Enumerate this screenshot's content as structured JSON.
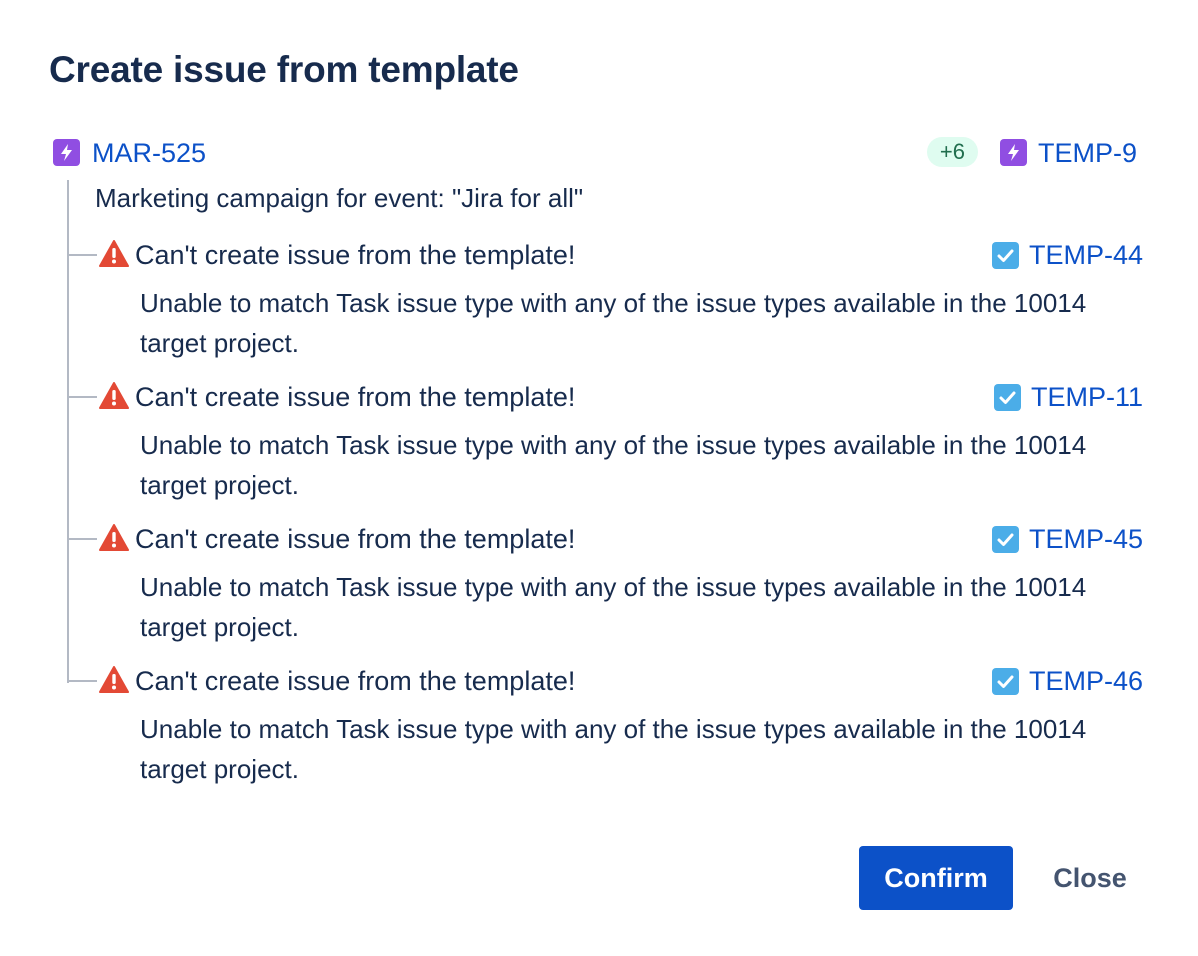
{
  "dialog": {
    "title": "Create issue from template",
    "confirm_label": "Confirm",
    "close_label": "Close"
  },
  "parent": {
    "key": "MAR-525",
    "icon": "epic-lightning-icon",
    "summary": "Marketing campaign for event: \"Jira for all\"",
    "more_badge": "+6",
    "target_key": "TEMP-9",
    "target_icon": "epic-lightning-icon"
  },
  "items": [
    {
      "error_title": "Can't create issue from the template!",
      "error_message": "Unable to match Task issue type with any of the issue types available in the 10014 target project.",
      "target_key": "TEMP-44",
      "icon": "task-checkbox-icon"
    },
    {
      "error_title": "Can't create issue from the template!",
      "error_message": "Unable to match Task issue type with any of the issue types available in the 10014 target project.",
      "target_key": "TEMP-11",
      "icon": "task-checkbox-icon"
    },
    {
      "error_title": "Can't create issue from the template!",
      "error_message": "Unable to match Task issue type with any of the issue types available in the 10014 target project.",
      "target_key": "TEMP-45",
      "icon": "task-checkbox-icon"
    },
    {
      "error_title": "Can't create issue from the template!",
      "error_message": "Unable to match Task issue type with any of the issue types available in the 10014 target project.",
      "target_key": "TEMP-46",
      "icon": "task-checkbox-icon"
    }
  ],
  "colors": {
    "primary": "#0c51c8",
    "epic": "#904ee2",
    "task": "#4bade8",
    "warning": "#e34935",
    "badge_bg": "#dffcf0",
    "badge_text": "#216e4e"
  }
}
